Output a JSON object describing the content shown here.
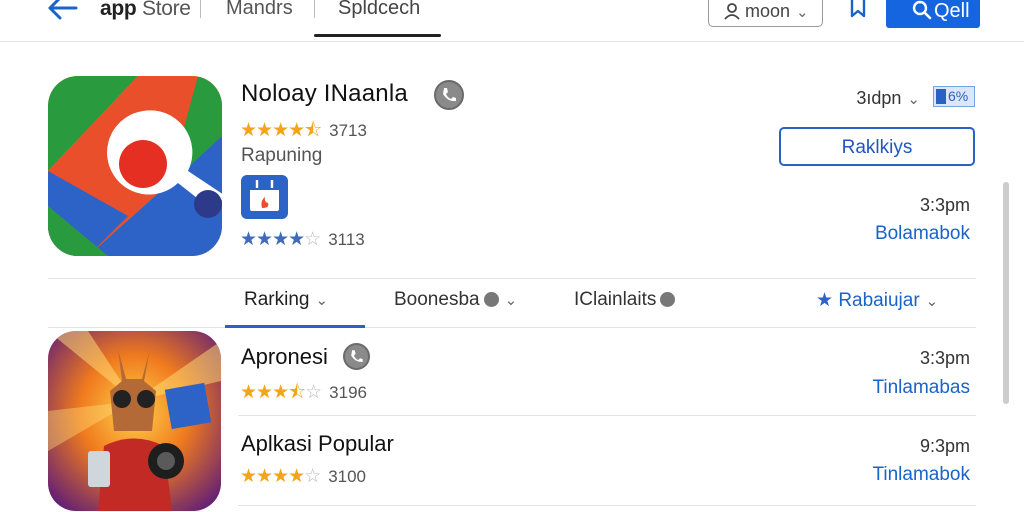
{
  "header": {
    "brand_bold": "app",
    "brand_light": "Store",
    "nav_item_1": "Mandrs",
    "nav_item_2": "Spldcech",
    "user_label": "moon",
    "search_label": "Qell"
  },
  "featured": {
    "title": "Noloay INaanla",
    "rating_count": "3713",
    "category": "Rapuning",
    "second_rating_count": "3113",
    "price": "3ıdpn",
    "pct_badge": "6%",
    "primary_button": "Raklkiys",
    "time": "3:3pm",
    "link": "Bolamabok",
    "rating_stars": 4.5,
    "second_rating_stars": 4
  },
  "tabs": [
    {
      "label": "Rarking"
    },
    {
      "label": "Boonesba"
    },
    {
      "label": "IClainlaits"
    },
    {
      "label": "Rabaiujar"
    }
  ],
  "list": [
    {
      "title": "Apronesi",
      "rating_count": "3196",
      "time": "3:3pm",
      "link": "Tinlamabas",
      "stars": 3.5
    },
    {
      "title": "Aplkasi Popular",
      "rating_count": "3100",
      "time": "9:3pm",
      "link": "Tinlamabok",
      "stars": 4
    }
  ],
  "colors": {
    "accent": "#1565e0",
    "star": "#f2a41b",
    "star_blue": "#3f6bb8"
  },
  "icons": [
    "back-arrow-icon",
    "user-icon",
    "bookmark-icon",
    "search-icon",
    "phone-icon",
    "star-icon",
    "chevron-down-icon"
  ]
}
